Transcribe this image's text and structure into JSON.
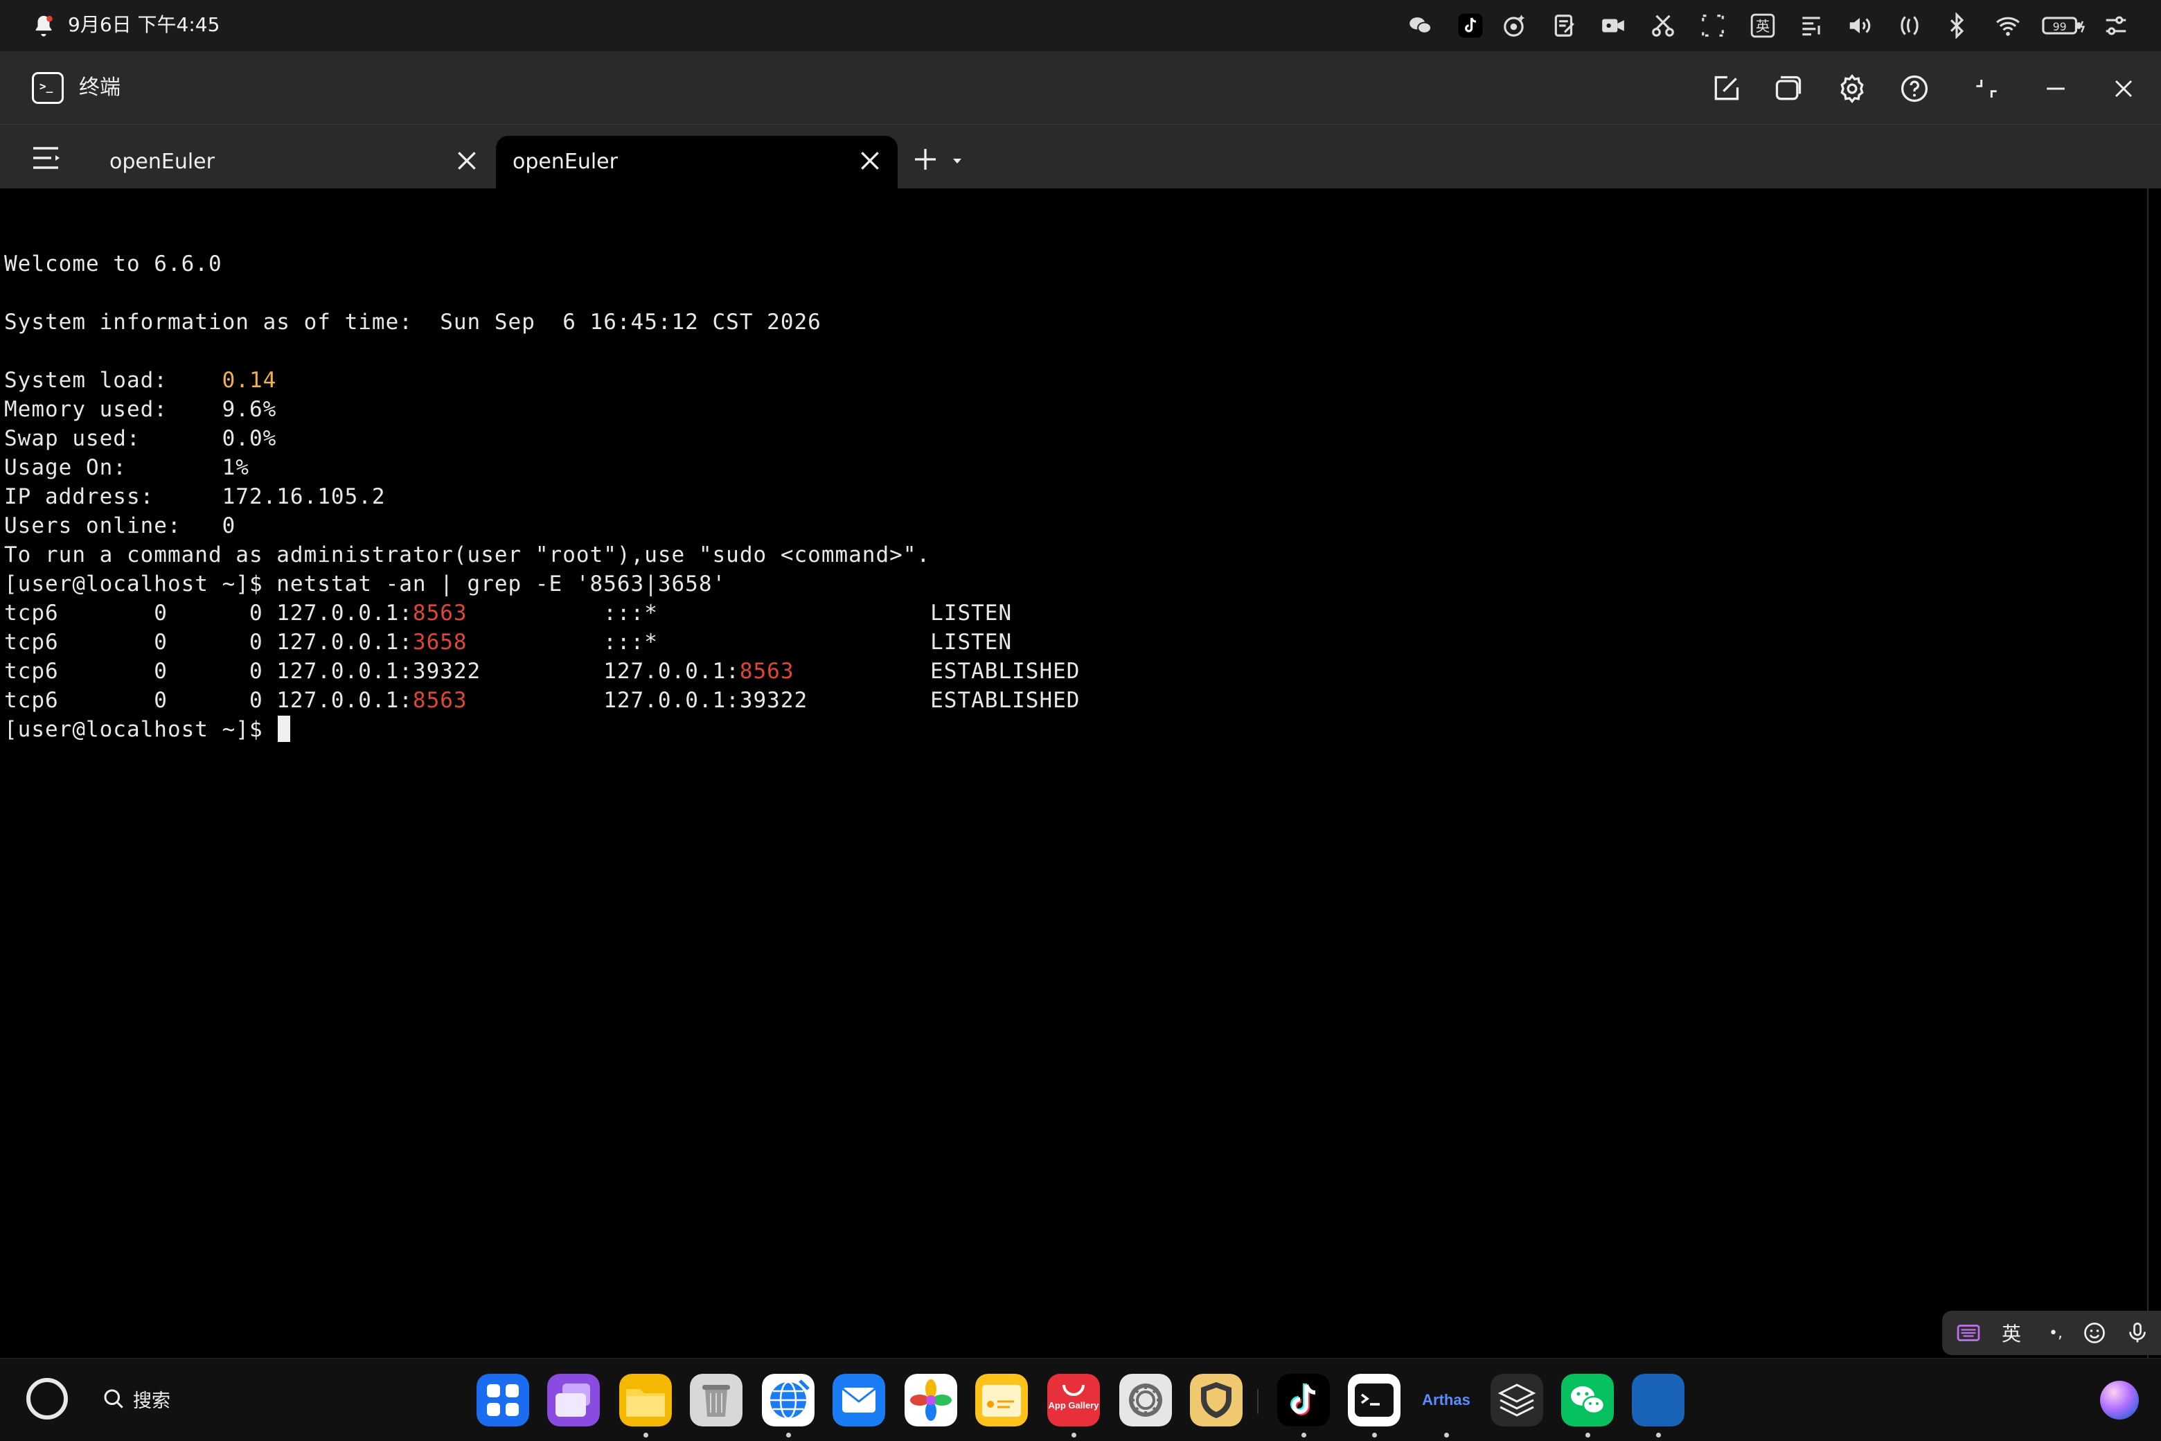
{
  "status_bar": {
    "datetime": "9月6日 下午4:45",
    "icons": [
      "bell-icon",
      "wechat-icon",
      "tiktok-icon",
      "app-icon",
      "notes-icon",
      "video-icon",
      "screenshot-icon",
      "scan-icon",
      "ime-en-icon",
      "text-icon",
      "volume-icon",
      "nfc-icon",
      "bluetooth-icon",
      "wifi-icon",
      "battery-icon",
      "control-center-icon"
    ],
    "ime_indicator": "英",
    "battery_level": "99"
  },
  "window": {
    "title": "终端"
  },
  "tabs": [
    {
      "label": "openEuler",
      "active": false
    },
    {
      "label": "openEuler",
      "active": true
    }
  ],
  "terminal": {
    "lines": [
      {
        "segments": [
          {
            "text": "Welcome to 6.6.0"
          }
        ]
      },
      {
        "segments": [
          {
            "text": ""
          }
        ]
      },
      {
        "segments": [
          {
            "text": "System information as of time:  Sun Sep  6 16:45:12 CST 2026"
          }
        ]
      },
      {
        "segments": [
          {
            "text": ""
          }
        ]
      },
      {
        "segments": [
          {
            "text": "System load:    "
          },
          {
            "text": "0.14",
            "color": "orange"
          }
        ]
      },
      {
        "segments": [
          {
            "text": "Memory used:    9.6%"
          }
        ]
      },
      {
        "segments": [
          {
            "text": "Swap used:      0.0%"
          }
        ]
      },
      {
        "segments": [
          {
            "text": "Usage On:       1%"
          }
        ]
      },
      {
        "segments": [
          {
            "text": "IP address:     172.16.105.2"
          }
        ]
      },
      {
        "segments": [
          {
            "text": "Users online:   0"
          }
        ]
      },
      {
        "segments": [
          {
            "text": "To run a command as administrator(user \"root\"),use \"sudo <command>\"."
          }
        ]
      },
      {
        "segments": [
          {
            "text": "[user@localhost ~]$ netstat -an | grep -E '8563|3658'"
          }
        ]
      },
      {
        "segments": [
          {
            "text": "tcp6       0      0 127.0.0.1:"
          },
          {
            "text": "8563",
            "color": "red"
          },
          {
            "text": "          :::*                    LISTEN"
          }
        ]
      },
      {
        "segments": [
          {
            "text": "tcp6       0      0 127.0.0.1:"
          },
          {
            "text": "3658",
            "color": "red"
          },
          {
            "text": "          :::*                    LISTEN"
          }
        ]
      },
      {
        "segments": [
          {
            "text": "tcp6       0      0 127.0.0.1:39322         127.0.0.1:"
          },
          {
            "text": "8563",
            "color": "red"
          },
          {
            "text": "          ESTABLISHED"
          }
        ]
      },
      {
        "segments": [
          {
            "text": "tcp6       0      0 127.0.0.1:"
          },
          {
            "text": "8563",
            "color": "red"
          },
          {
            "text": "          127.0.0.1:39322         ESTABLISHED"
          }
        ]
      },
      {
        "segments": [
          {
            "text": "[user@localhost ~]$ "
          }
        ],
        "cursor": true
      }
    ]
  },
  "ime_toolbar": {
    "language": "英",
    "punct": "•,"
  },
  "dock": {
    "search_label": "搜索",
    "apps": [
      {
        "name": "app-center",
        "running": false
      },
      {
        "name": "multi-window",
        "running": false
      },
      {
        "name": "files",
        "running": true
      },
      {
        "name": "recycle-bin",
        "running": false
      },
      {
        "name": "browser",
        "running": true
      },
      {
        "name": "mail",
        "running": false
      },
      {
        "name": "gallery",
        "running": false
      },
      {
        "name": "memo",
        "running": false
      },
      {
        "name": "app-gallery",
        "running": true
      },
      {
        "name": "settings",
        "running": false
      },
      {
        "name": "security",
        "running": false
      },
      {
        "name": "tiktok",
        "running": true
      },
      {
        "name": "terminal",
        "running": true
      },
      {
        "name": "arthas",
        "running": true
      },
      {
        "name": "layers",
        "running": false
      },
      {
        "name": "wechat",
        "running": true
      },
      {
        "name": "blue-app",
        "running": true
      }
    ],
    "app_gallery_label": "App Gallery",
    "arthas_label": "Arthas"
  },
  "colors": {
    "terminal_bg": "#000000",
    "chrome_bg": "#2a2a2a",
    "status_bg": "#1b1b1b",
    "highlight_orange": "#f0b050",
    "highlight_red": "#e0453a"
  }
}
